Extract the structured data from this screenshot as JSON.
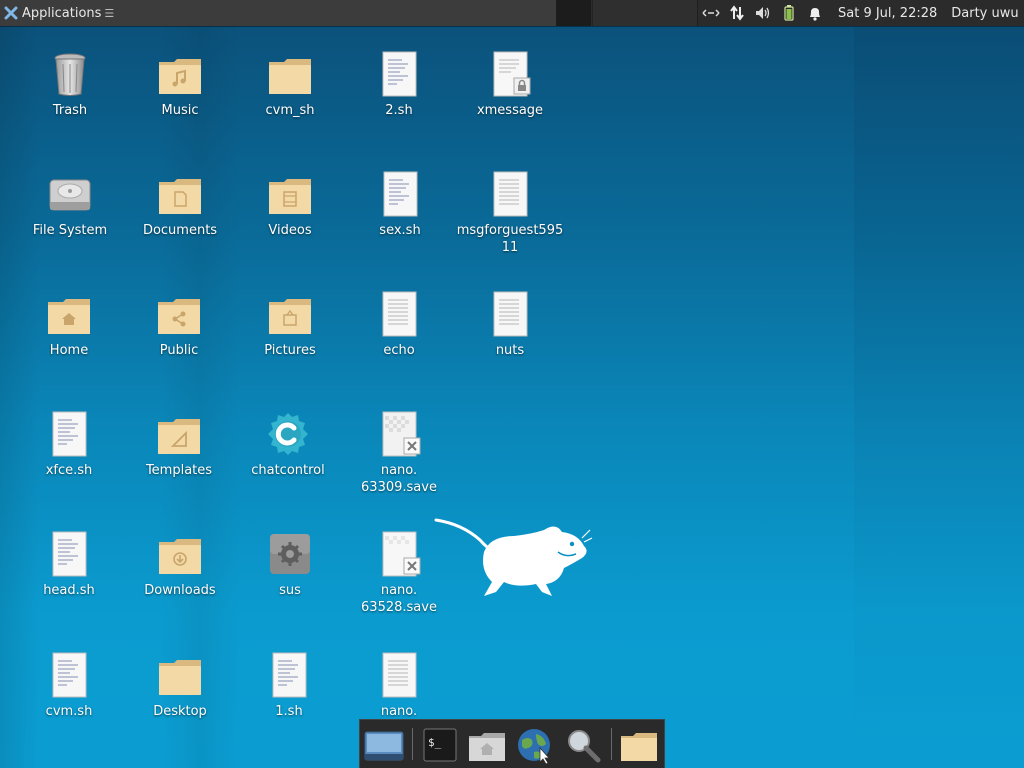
{
  "panel": {
    "applications_label": "Applications",
    "menu_glyph": "☰",
    "clock": "Sat  9 Jul, 22:28",
    "user": "Darty uwu",
    "tray_icons": [
      "network-arrows-icon",
      "updown-arrows-icon",
      "volume-icon",
      "battery-icon",
      "notification-bell-icon"
    ]
  },
  "desktop": {
    "icons": [
      {
        "label": "Trash",
        "icon": "trash-icon"
      },
      {
        "label": "Music",
        "icon": "folder-music-icon"
      },
      {
        "label": "cvm_sh",
        "icon": "folder-icon"
      },
      {
        "label": "2.sh",
        "icon": "text-file-icon"
      },
      {
        "label": "xmessage",
        "icon": "locked-file-icon"
      },
      {
        "label": "File System",
        "icon": "drive-icon"
      },
      {
        "label": "Documents",
        "icon": "folder-documents-icon"
      },
      {
        "label": "Videos",
        "icon": "folder-videos-icon"
      },
      {
        "label": "sex.sh",
        "icon": "text-file-icon"
      },
      {
        "label": "msgforguest59511",
        "icon": "text-file-icon"
      },
      {
        "label": "Home",
        "icon": "folder-home-icon"
      },
      {
        "label": "Public",
        "icon": "folder-public-icon"
      },
      {
        "label": "Pictures",
        "icon": "folder-pictures-icon"
      },
      {
        "label": "echo",
        "icon": "text-file-icon"
      },
      {
        "label": "nuts",
        "icon": "text-file-icon"
      },
      {
        "label": "xfce.sh",
        "icon": "text-file-icon"
      },
      {
        "label": "Templates",
        "icon": "folder-templates-icon"
      },
      {
        "label": "chatcontrol",
        "icon": "chatcontrol-app-icon"
      },
      {
        "label": "nano.\n63309.save",
        "icon": "broken-file-icon"
      },
      {
        "label": "head.sh",
        "icon": "text-file-icon"
      },
      {
        "label": "Downloads",
        "icon": "folder-downloads-icon"
      },
      {
        "label": "sus",
        "icon": "gear-settings-icon"
      },
      {
        "label": "nano.\n63528.save",
        "icon": "broken-file-icon"
      },
      {
        "label": "cvm.sh",
        "icon": "text-file-icon"
      },
      {
        "label": "Desktop",
        "icon": "folder-icon"
      },
      {
        "label": "1.sh",
        "icon": "text-file-icon"
      },
      {
        "label": "nano.",
        "icon": "text-file-icon"
      }
    ]
  },
  "dock": {
    "items": [
      "show-desktop-icon",
      "terminal-icon",
      "home-folder-icon",
      "web-browser-icon",
      "search-icon",
      "file-manager-icon"
    ]
  },
  "colors": {
    "panel_bg": "#2b2b2b",
    "desktop_top": "#0b4f78",
    "desktop_bottom": "#0b9dd2",
    "folder": "#f3d9a6",
    "folder_dark": "#d9b97f"
  }
}
